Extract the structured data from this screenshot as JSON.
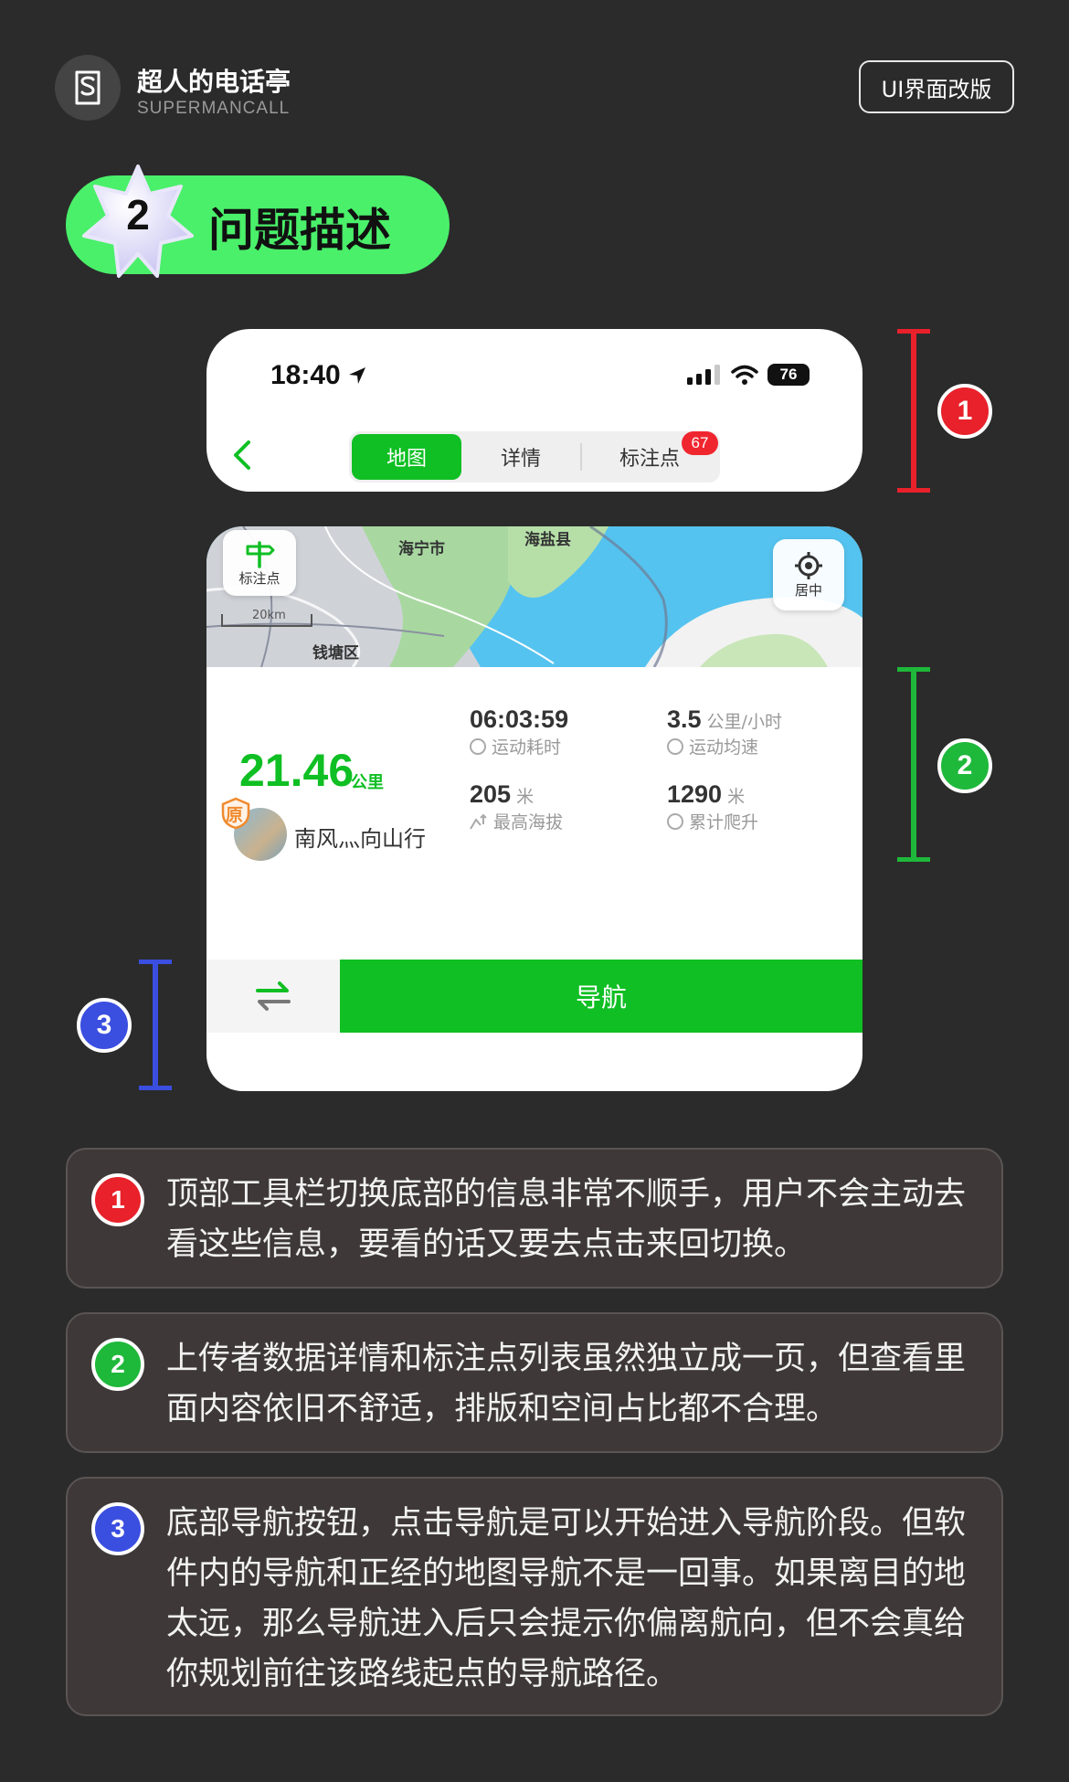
{
  "brand": {
    "title": "超人的电话亭",
    "subtitle": "SUPERMANCALL",
    "tag": "UI界面改版"
  },
  "section": {
    "number": "2",
    "title": "问题描述"
  },
  "phone": {
    "time": "18:40",
    "battery": "76",
    "tabs": [
      "地图",
      "详情",
      "标注点"
    ],
    "badge": "67"
  },
  "map": {
    "label_haining": "海宁市",
    "label_haiyan": "海盐县",
    "label_qiantang": "钱塘区",
    "scale": "20km",
    "marker_btn": "标注点",
    "center_btn": "居中"
  },
  "stats": {
    "distance": "21.46",
    "distance_unit": "公里",
    "badge": "原",
    "user": "南风灬向山行",
    "time_value": "06:03:59",
    "time_label": "运动耗时",
    "speed_value": "3.5",
    "speed_unit": "公里/小时",
    "speed_label": "运动均速",
    "altitude_value": "205",
    "altitude_unit": "米",
    "altitude_label": "最高海拔",
    "climb_value": "1290",
    "climb_unit": "米",
    "climb_label": "累计爬升",
    "nav_button": "导航"
  },
  "markers": [
    "1",
    "2",
    "3"
  ],
  "notes": [
    {
      "num": "1",
      "text": "顶部工具栏切换底部的信息非常不顺手，用户不会主动去看这些信息，要看的话又要去点击来回切换。"
    },
    {
      "num": "2",
      "text": "上传者数据详情和标注点列表虽然独立成一页，但查看里面内容依旧不舒适，排版和空间占比都不合理。"
    },
    {
      "num": "3",
      "text": "底部导航按钮，点击导航是可以开始进入导航阶段。但软件内的导航和正经的地图导航不是一回事。如果离目的地太远，那么导航进入后只会提示你偏离航向，但不会真给你规划前往该路线起点的导航路径。"
    }
  ],
  "colors": {
    "red": "#e8212b",
    "green": "#1eb83a",
    "blue": "#3a4ee0",
    "accent": "#0fbf23"
  }
}
